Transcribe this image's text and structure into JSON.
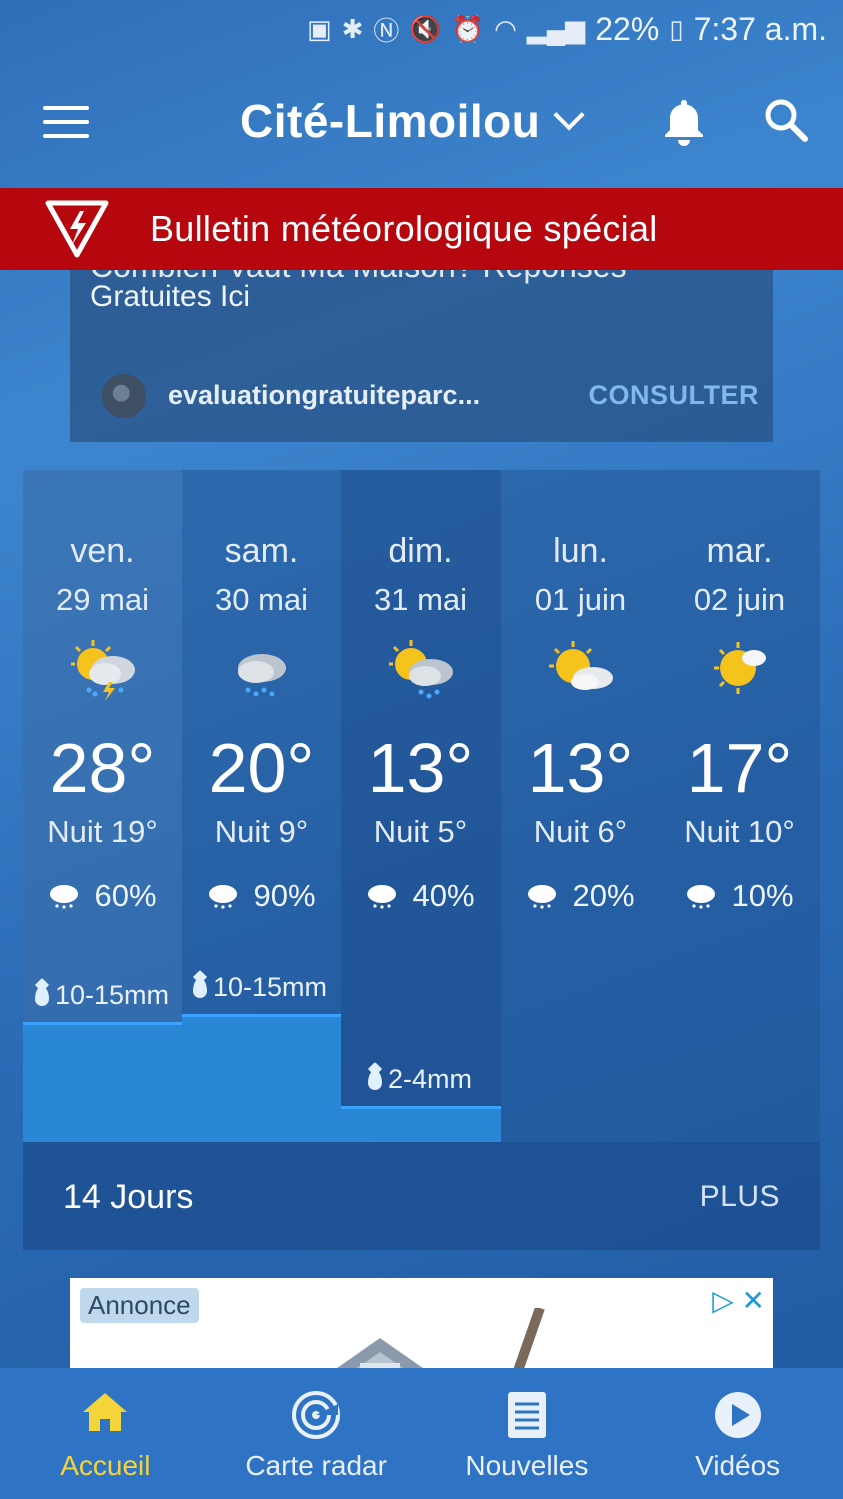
{
  "status_bar": {
    "battery": "22%",
    "time": "7:37 a.m."
  },
  "header": {
    "location": "Cité-Limoilou"
  },
  "alert": {
    "text": "Bulletin météorologique spécial"
  },
  "top_ad": {
    "clipped_line": "Combien Vaut Ma Maison? Réponses",
    "title": "Gratuites Ici",
    "domain": "evaluationgratuiteparc...",
    "cta": "CONSULTER"
  },
  "forecast": {
    "days": [
      {
        "name": "ven.",
        "date": "29 mai",
        "icon": "sun-cloud-thunder-icon",
        "high": "28°",
        "low": "Nuit 19°",
        "pop": "60%",
        "precip": "10-15mm"
      },
      {
        "name": "sam.",
        "date": "30 mai",
        "icon": "cloud-rain-icon",
        "high": "20°",
        "low": "Nuit 9°",
        "pop": "90%",
        "precip": "10-15mm"
      },
      {
        "name": "dim.",
        "date": "31 mai",
        "icon": "sun-cloud-rain-icon",
        "high": "13°",
        "low": "Nuit 5°",
        "pop": "40%",
        "precip": "2-4mm"
      },
      {
        "name": "lun.",
        "date": "01 juin",
        "icon": "sun-cloud-icon",
        "high": "13°",
        "low": "Nuit 6°",
        "pop": "20%",
        "precip": ""
      },
      {
        "name": "mar.",
        "date": "02 juin",
        "icon": "sun-small-cloud-icon",
        "high": "17°",
        "low": "Nuit 10°",
        "pop": "10%",
        "precip": ""
      }
    ],
    "footer_label": "14 Jours",
    "more_label": "PLUS"
  },
  "bottom_ad": {
    "badge": "Annonce"
  },
  "nav": {
    "items": [
      {
        "label": "Accueil",
        "icon": "home-icon",
        "active": true
      },
      {
        "label": "Carte radar",
        "icon": "radar-icon",
        "active": false
      },
      {
        "label": "Nouvelles",
        "icon": "news-icon",
        "active": false
      },
      {
        "label": "Vidéos",
        "icon": "play-icon",
        "active": false
      }
    ]
  },
  "colors": {
    "alert_red": "#b5070d",
    "active_nav": "#f3d53a",
    "link_blue": "#7fb8ec"
  }
}
